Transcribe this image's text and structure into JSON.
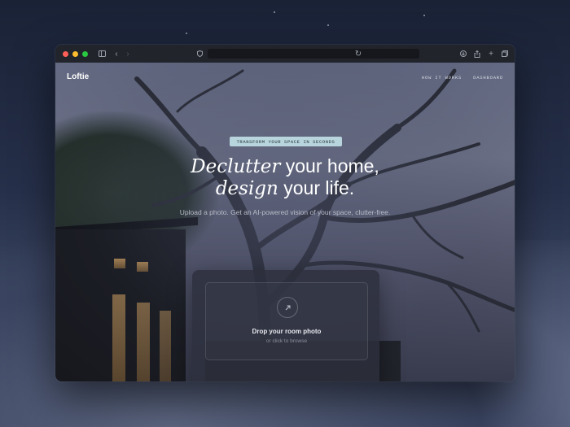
{
  "site": {
    "logo": "Loftie",
    "nav": [
      "HOW IT WORKS",
      "DASHBOARD"
    ]
  },
  "hero": {
    "badge": "TRANSFORM YOUR SPACE IN SECONDS",
    "headline_line1_italic": "Declutter",
    "headline_line1_rest": " your home,",
    "headline_line2_italic": "design",
    "headline_line2_rest": " your life.",
    "subtext": "Upload a photo. Get an AI-powered vision of your space, clutter-free."
  },
  "upload": {
    "title": "Drop your room photo",
    "subtitle": "or click to browse"
  },
  "icons": {
    "sidebar": "sidebar-icon",
    "back": "chevron-left-icon",
    "forward": "chevron-right-icon",
    "shield": "shield-icon",
    "reload": "reload-icon",
    "download": "download-icon",
    "share": "share-icon",
    "new_tab": "plus-icon",
    "tabs": "tabs-icon",
    "upload": "arrow-up-right-icon"
  }
}
